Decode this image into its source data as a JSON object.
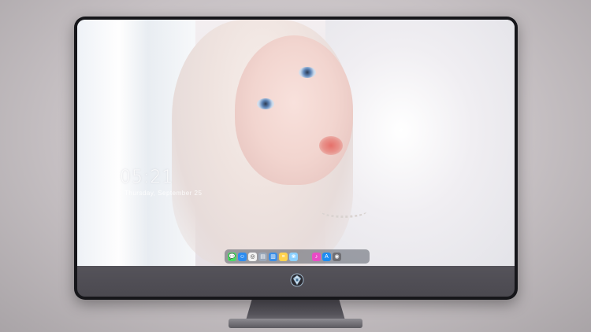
{
  "lock_screen": {
    "time": "05:21",
    "date": "Thursday, September 25"
  },
  "dock": {
    "apps": [
      {
        "name": "messages-icon",
        "color": "#4cd964",
        "glyph": "💬"
      },
      {
        "name": "finder-icon",
        "color": "#2d8cf0",
        "glyph": "☺"
      },
      {
        "name": "safari-icon",
        "color": "#f2f2f2",
        "glyph": "◎"
      },
      {
        "name": "preview-icon",
        "color": "#9aa7b8",
        "glyph": "▤"
      },
      {
        "name": "keynote-icon",
        "color": "#3a8ee6",
        "glyph": "▥"
      },
      {
        "name": "notes-icon",
        "color": "#ffd24d",
        "glyph": "≡"
      },
      {
        "name": "photos-icon",
        "color": "#8bd0ff",
        "glyph": "❀"
      },
      {
        "name": "itunes-icon",
        "color": "#e94cc6",
        "glyph": "♪"
      },
      {
        "name": "app-store-icon",
        "color": "#1c8cf2",
        "glyph": "A"
      },
      {
        "name": "camera-icon",
        "color": "#6f6f74",
        "glyph": "◉"
      }
    ]
  },
  "colors": {
    "frame": "#16161a",
    "chin": "#4f4d54",
    "background": "#cfc9cc"
  }
}
